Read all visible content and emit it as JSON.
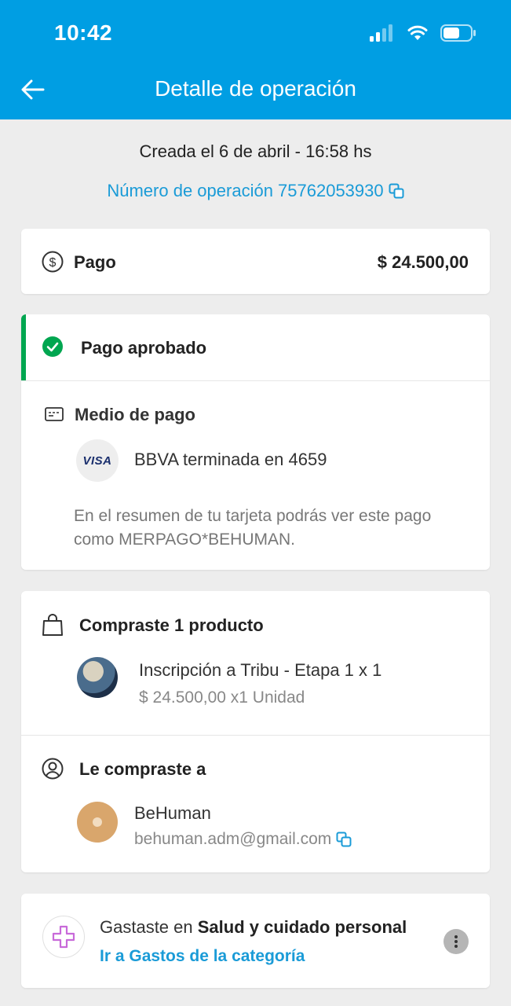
{
  "status_bar": {
    "time": "10:42"
  },
  "header": {
    "title": "Detalle de operación"
  },
  "operation": {
    "created": "Creada el 6 de abril - 16:58 hs",
    "number_label": "Número de operación 75762053930"
  },
  "payment": {
    "label": "Pago",
    "amount": "$ 24.500,00"
  },
  "status": {
    "label": "Pago aprobado",
    "method_title": "Medio de pago",
    "card_brand": "VISA",
    "card_description": "BBVA terminada en 4659",
    "statement_note": "En el resumen de tu tarjeta podrás ver este pago como MERPAGO*BEHUMAN."
  },
  "purchase": {
    "title": "Compraste 1 producto",
    "product_name": "Inscripción a Tribu - Etapa 1 x 1",
    "product_price": "$ 24.500,00 x1 Unidad",
    "seller_title": "Le compraste a",
    "seller_name": "BeHuman",
    "seller_email": "behuman.adm@gmail.com"
  },
  "category": {
    "prefix": "Gastaste en ",
    "name": "Salud y cuidado personal",
    "link": "Ir a Gastos de la categoría"
  },
  "colors": {
    "brand": "#009ee3",
    "link": "#1a9bd7",
    "success": "#00a650",
    "category_icon": "#c86ad9"
  }
}
